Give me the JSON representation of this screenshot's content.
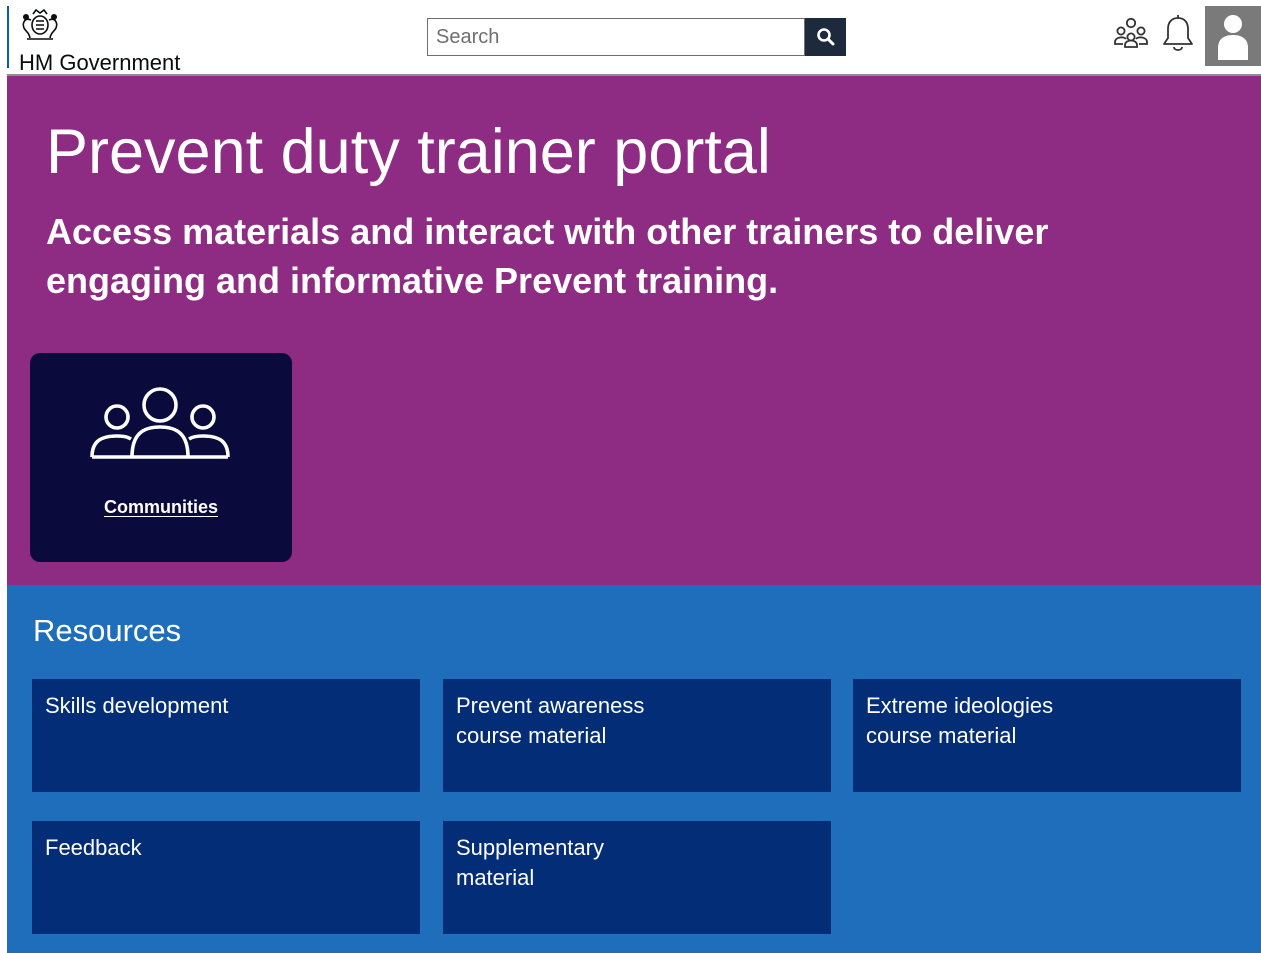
{
  "header": {
    "logo_text": "HM Government",
    "search": {
      "placeholder": "Search",
      "value": ""
    },
    "icons": {
      "communities": "people-group-icon",
      "notifications": "bell-icon",
      "profile": "user-avatar-icon"
    }
  },
  "hero": {
    "title": "Prevent duty trainer portal",
    "subtitle": "Access materials and interact with other trainers to deliver engaging and informative Prevent training.",
    "communities_card": {
      "label": "Communities"
    }
  },
  "resources": {
    "heading": "Resources",
    "tiles": [
      {
        "label": "Skills development"
      },
      {
        "label": "Prevent awareness course material"
      },
      {
        "label": "Extreme ideologies course material"
      },
      {
        "label": "Feedback"
      },
      {
        "label": "Supplementary material"
      }
    ]
  },
  "colors": {
    "hero_bg": "#8e2b83",
    "resources_bg": "#1e6ebb",
    "tile_bg": "#032d77",
    "card_bg": "#0a0a3c",
    "search_button_bg": "#1d2a3d",
    "avatar_bg": "#7a7a7a"
  }
}
